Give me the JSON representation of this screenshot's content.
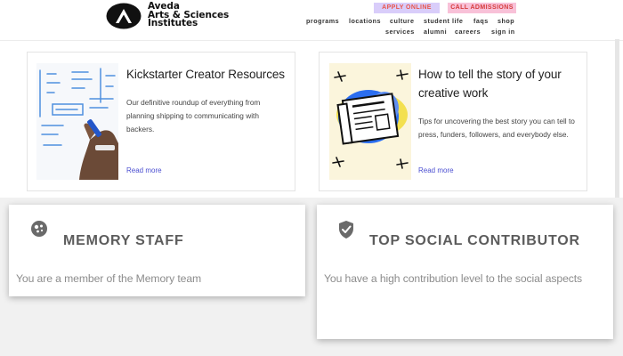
{
  "header": {
    "logo_icon": "triangle-a-logo-icon",
    "brand_lines": [
      "Aveda",
      "Arts & Sciences",
      "Institutes"
    ],
    "apply_label": "APPLY ONLINE",
    "call_label": "CALL ADMISSIONS",
    "nav_row1": [
      "programs",
      "locations",
      "culture",
      "student life",
      "faqs",
      "shop"
    ],
    "nav_row2": [
      "services",
      "alumni",
      "careers",
      "sign in"
    ]
  },
  "cards": [
    {
      "title": "Kickstarter Creator Resources",
      "description": "Our definitive roundup of everything from planning shipping to communicating with backers.",
      "read_more": "Read more",
      "image_icon": "whiteboard-drawing-icon"
    },
    {
      "title": "How to tell the story of your creative work",
      "description": "Tips for uncovering the best story you can tell to press, funders, followers, and everybody else.",
      "read_more": "Read more",
      "image_icon": "newspaper-illustration-icon"
    }
  ],
  "badges": [
    {
      "icon": "memory-badge-icon",
      "title": "MEMORY STAFF",
      "description": "You are a member of the Memory team"
    },
    {
      "icon": "shield-check-icon",
      "title": "TOP SOCIAL CONTRIBUTOR",
      "description": "You have a high contribution level to the social aspects"
    }
  ],
  "colors": {
    "apply_bg": "#d9cdfa",
    "call_bg": "#f8c1d8",
    "link": "#4b4fd1",
    "badge_title": "#5c5c5c"
  }
}
